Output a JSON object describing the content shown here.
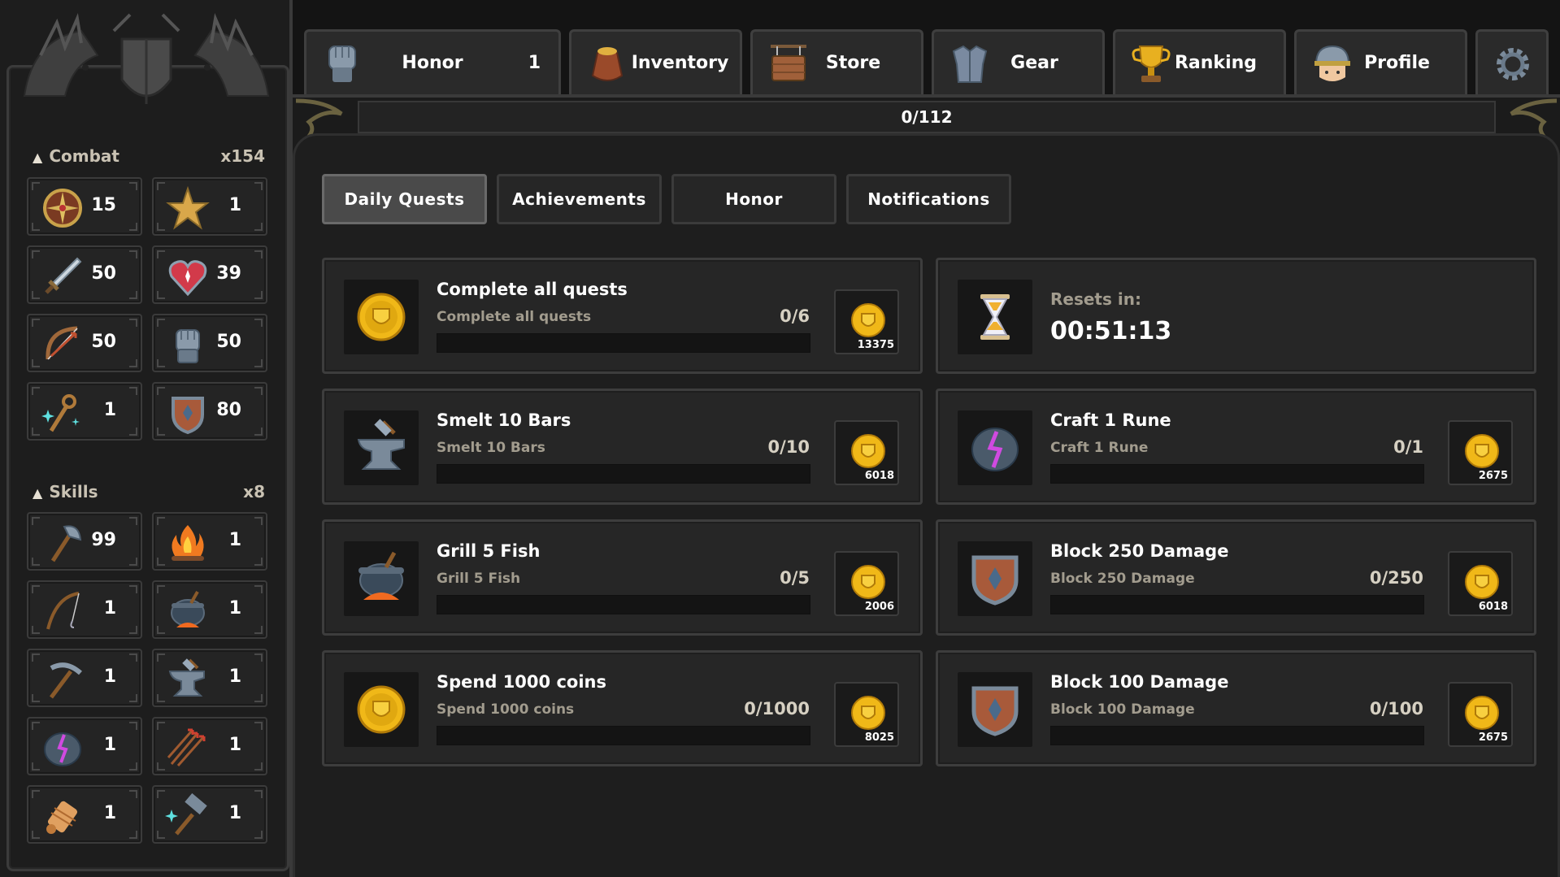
{
  "nav": {
    "tabs": [
      {
        "label": "Honor",
        "badge": "1",
        "icon": "fist-icon"
      },
      {
        "label": "Inventory",
        "icon": "bag-icon"
      },
      {
        "label": "Store",
        "icon": "signboard-icon"
      },
      {
        "label": "Gear",
        "icon": "armor-icon"
      },
      {
        "label": "Ranking",
        "icon": "trophy-icon"
      },
      {
        "label": "Profile",
        "icon": "helmet-avatar-icon"
      }
    ],
    "settings_icon": "gear-icon"
  },
  "progress": {
    "text": "0/112"
  },
  "sidebar": {
    "combat": {
      "title": "Combat",
      "count": "x154",
      "stats": [
        {
          "icon": "compass-icon",
          "value": "15"
        },
        {
          "icon": "star-icon",
          "value": "1"
        },
        {
          "icon": "sword-icon",
          "value": "50"
        },
        {
          "icon": "heart-icon",
          "value": "39"
        },
        {
          "icon": "bow-icon",
          "value": "50"
        },
        {
          "icon": "gauntlet-icon",
          "value": "50"
        },
        {
          "icon": "magic-staff-icon",
          "value": "1"
        },
        {
          "icon": "shield-icon",
          "value": "80"
        }
      ]
    },
    "skills": {
      "title": "Skills",
      "count": "x8",
      "stats": [
        {
          "icon": "axe-icon",
          "value": "99"
        },
        {
          "icon": "campfire-icon",
          "value": "1"
        },
        {
          "icon": "fishing-rod-icon",
          "value": "1"
        },
        {
          "icon": "cauldron-icon",
          "value": "1"
        },
        {
          "icon": "pickaxe-icon",
          "value": "1"
        },
        {
          "icon": "anvil-icon",
          "value": "1"
        },
        {
          "icon": "rune-icon",
          "value": "1"
        },
        {
          "icon": "arrows-icon",
          "value": "1"
        },
        {
          "icon": "thread-spool-icon",
          "value": "1"
        },
        {
          "icon": "enchanted-hammer-icon",
          "value": "1"
        }
      ]
    }
  },
  "subtabs": [
    "Daily Quests",
    "Achievements",
    "Honor",
    "Notifications"
  ],
  "active_subtab": "Daily Quests",
  "quests": [
    {
      "title": "Complete all quests",
      "subtitle": "Complete all quests",
      "progress": "0/6",
      "reward": "13375",
      "icon": "coin-icon"
    },
    {
      "title": "Smelt 10 Bars",
      "subtitle": "Smelt 10 Bars",
      "progress": "0/10",
      "reward": "6018",
      "icon": "anvil-icon"
    },
    {
      "title": "Craft 1 Rune",
      "subtitle": "Craft 1 Rune",
      "progress": "0/1",
      "reward": "2675",
      "icon": "rune-icon"
    },
    {
      "title": "Grill 5 Fish",
      "subtitle": "Grill 5 Fish",
      "progress": "0/5",
      "reward": "2006",
      "icon": "cauldron-icon"
    },
    {
      "title": "Block 250 Damage",
      "subtitle": "Block 250 Damage",
      "progress": "0/250",
      "reward": "6018",
      "icon": "shield-icon"
    },
    {
      "title": "Spend 1000 coins",
      "subtitle": "Spend 1000 coins",
      "progress": "0/1000",
      "reward": "8025",
      "icon": "coin-icon"
    },
    {
      "title": "Block 100 Damage",
      "subtitle": "Block 100 Damage",
      "progress": "0/100",
      "reward": "2675",
      "icon": "shield-icon"
    }
  ],
  "reset": {
    "label": "Resets in:",
    "time": "00:51:13",
    "icon": "hourglass-icon"
  },
  "colors": {
    "gold": "#e8b30f",
    "panel": "#262626",
    "muted_text": "#a29c8e"
  }
}
